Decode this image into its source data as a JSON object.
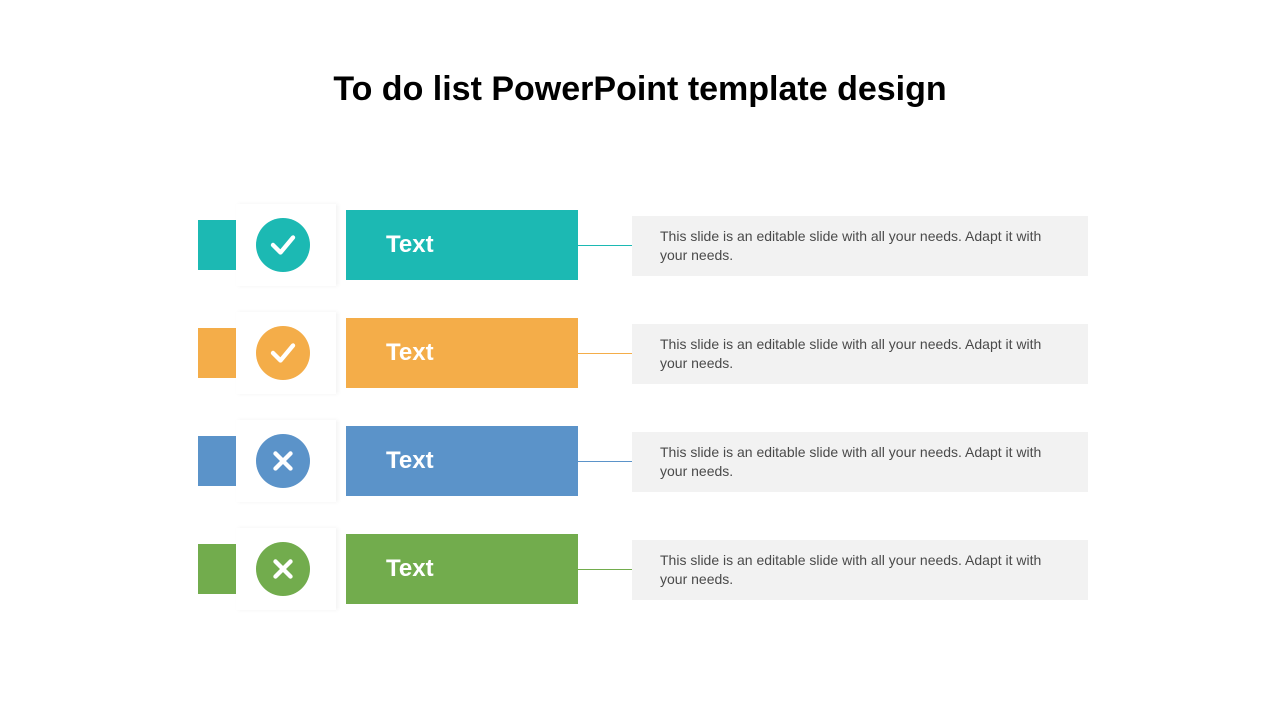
{
  "title": "To do list PowerPoint template design",
  "rows": [
    {
      "label": "Text",
      "description": "This slide is an editable slide with all your needs. Adapt it with your needs.",
      "color": "#1cb9b3",
      "icon": "check"
    },
    {
      "label": "Text",
      "description": "This slide is an editable slide with all your needs. Adapt it with your needs.",
      "color": "#f4ad49",
      "icon": "check"
    },
    {
      "label": "Text",
      "description": "This slide is an editable slide with all your needs. Adapt it with your needs.",
      "color": "#5b93c9",
      "icon": "cross"
    },
    {
      "label": "Text",
      "description": "This slide is an editable slide with all your needs. Adapt it with your needs.",
      "color": "#72ac4d",
      "icon": "cross"
    }
  ]
}
